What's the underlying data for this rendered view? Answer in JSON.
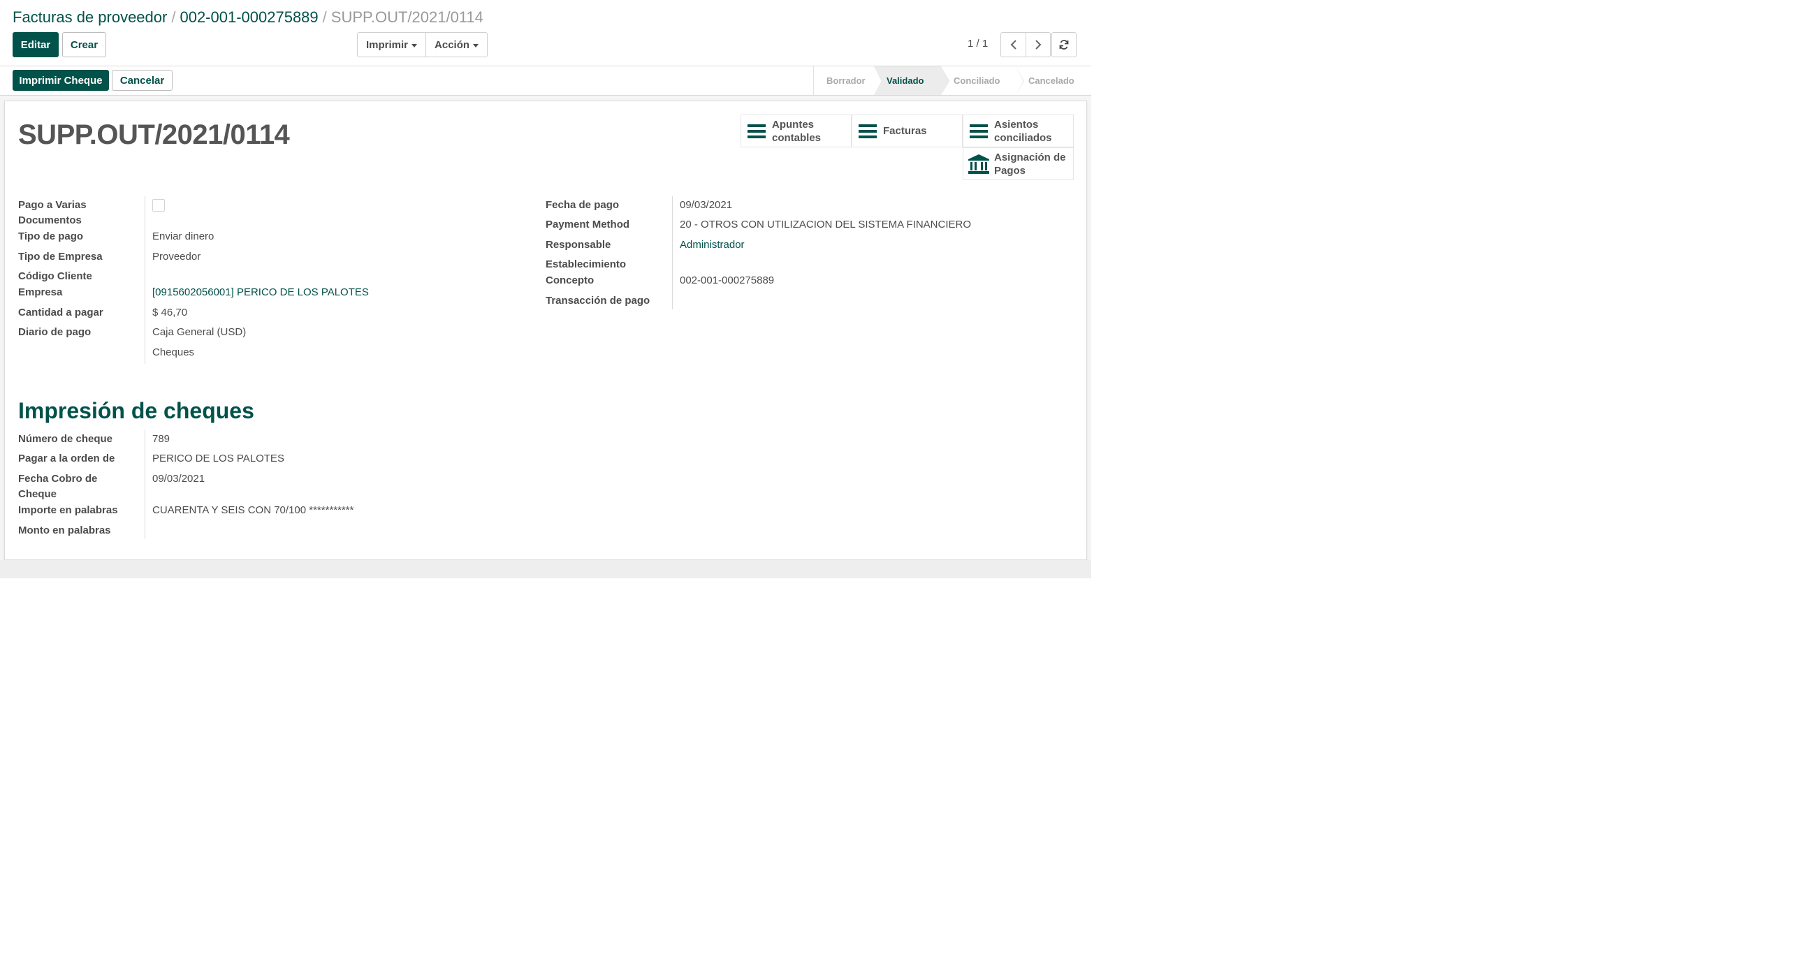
{
  "breadcrumb": {
    "items": [
      "Facturas de proveedor",
      "002-001-000275889"
    ],
    "current": "SUPP.OUT/2021/0114",
    "separator": "/"
  },
  "toolbar": {
    "edit_label": "Editar",
    "create_label": "Crear",
    "print_label": "Imprimir",
    "action_label": "Acción",
    "pager_value": "1 / 1"
  },
  "statusbar": {
    "print_check_label": "Imprimir Cheque",
    "cancel_label": "Cancelar",
    "stages": [
      "Borrador",
      "Validado",
      "Conciliado",
      "Cancelado"
    ],
    "current_stage": "Validado"
  },
  "record": {
    "title": "SUPP.OUT/2021/0114"
  },
  "smart_buttons": {
    "journal_items": "Apuntes contables",
    "invoices": "Facturas",
    "reconciled_entries": "Asientos conciliados",
    "payment_assignment": "Asignación de Pagos"
  },
  "left_fields": {
    "multi_docs_label": "Pago a Varias Documentos",
    "payment_type_label": "Tipo de pago",
    "payment_type_value": "Enviar dinero",
    "partner_type_label": "Tipo de Empresa",
    "partner_type_value": "Proveedor",
    "client_code_label": "Código Cliente",
    "partner_label": "Empresa",
    "partner_value": "[0915602056001] PERICO DE LOS PALOTES",
    "amount_label": "Cantidad a pagar",
    "amount_value": "$ 46,70",
    "journal_label": "Diario de pago",
    "journal_value": "Caja General (USD)",
    "journal_extra_value": "Cheques"
  },
  "right_fields": {
    "payment_date_label": "Fecha de pago",
    "payment_date_value": "09/03/2021",
    "payment_method_label": "Payment Method",
    "payment_method_value": "20 - OTROS CON UTILIZACION DEL SISTEMA FINANCIERO",
    "responsible_label": "Responsable",
    "responsible_value": "Administrador",
    "establishment_label": "Establecimiento",
    "concept_label": "Concepto",
    "concept_value": "002-001-000275889",
    "transaction_label": "Transacción de pago"
  },
  "check_section": {
    "title": "Impresión de cheques",
    "check_number_label": "Número de cheque",
    "check_number_value": "789",
    "pay_to_label": "Pagar a la orden de",
    "pay_to_value": "PERICO DE LOS PALOTES",
    "cash_date_label": "Fecha Cobro de Cheque",
    "cash_date_value": "09/03/2021",
    "amount_words_label": "Importe en palabras",
    "amount_words_value": "CUARENTA Y SEIS CON 70/100 ***********",
    "amount_words2_label": "Monto en palabras"
  },
  "colors": {
    "primary": "#00524a",
    "text": "#4c4c4c",
    "muted": "#a9a9a9"
  }
}
